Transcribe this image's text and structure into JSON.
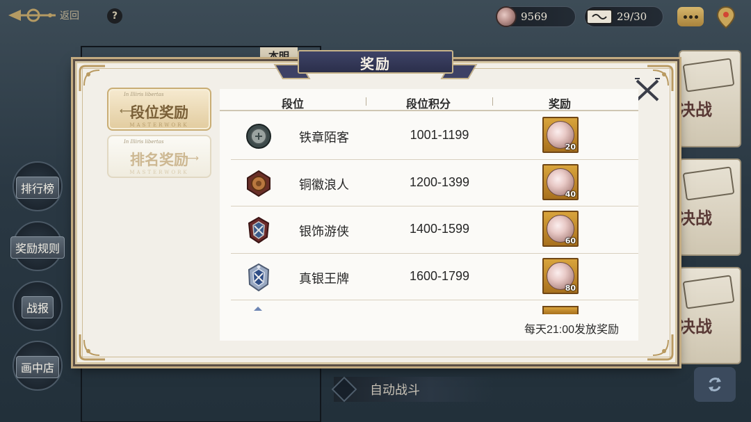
{
  "topbar": {
    "back_label": "返回",
    "help_glyph": "?",
    "coins": "9569",
    "tickets": "29/30",
    "icons": [
      "back-ornament-icon",
      "help-icon",
      "coin-icon",
      "ticket-icon",
      "chat-icon",
      "location-pin-icon"
    ]
  },
  "left_menu": [
    {
      "label": "排行榜"
    },
    {
      "label": "奖励规则"
    },
    {
      "label": "战报"
    },
    {
      "label": "画中店"
    }
  ],
  "background": {
    "tab_label": "本明",
    "side_card_label": "决战",
    "auto_battle_label": "自动战斗"
  },
  "dialog": {
    "title": "奖励",
    "tabs": [
      {
        "label": "段位奖励",
        "small": "In Illiris libertas",
        "sub": "MASTERWORK",
        "active": true
      },
      {
        "label": "排名奖励",
        "small": "In Illiris libertas",
        "sub": "MASTERWORK",
        "active": false
      }
    ],
    "table": {
      "headers": {
        "rank": "段位",
        "points": "段位积分",
        "reward": "奖励"
      },
      "rows": [
        {
          "name": "铁章陌客",
          "range": "1001-1199",
          "reward_qty": "20",
          "badge": "iron-badge-icon"
        },
        {
          "name": "铜徽浪人",
          "range": "1200-1399",
          "reward_qty": "40",
          "badge": "bronze-badge-icon"
        },
        {
          "name": "银饰游侠",
          "range": "1400-1599",
          "reward_qty": "60",
          "badge": "silver-badge-icon"
        },
        {
          "name": "真银王牌",
          "range": "1600-1799",
          "reward_qty": "80",
          "badge": "true-silver-badge-icon"
        }
      ]
    },
    "footnote": "每天21:00发放奖励"
  },
  "colors": {
    "dialog_bg": "#f2efe8",
    "gold_frame": "#c3ab80",
    "title_banner": "#2b2f4b",
    "reward_box": "#d9a43c"
  }
}
